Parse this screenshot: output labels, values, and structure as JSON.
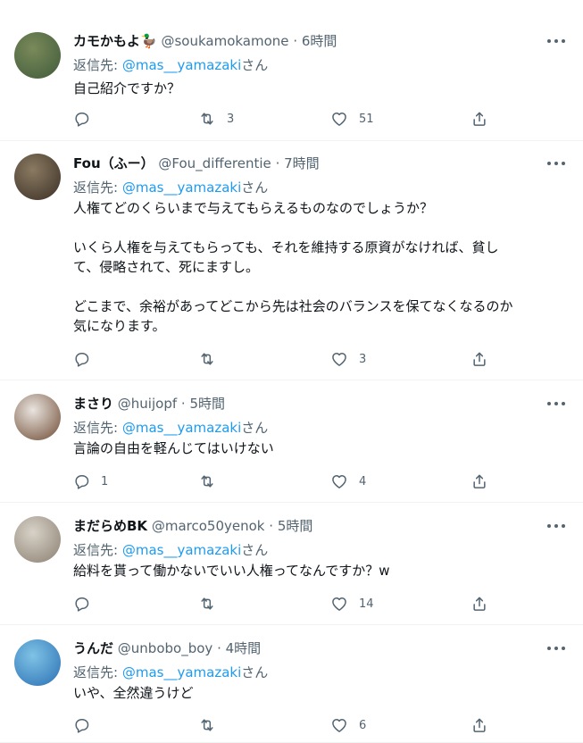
{
  "tweets": [
    {
      "name": "カモかもよ",
      "name_emoji": "🦆",
      "handle": "@soukamokamone",
      "dot": "·",
      "time": "6時間",
      "reply_prefix": "返信先:",
      "reply_to": "@mas__yamazaki",
      "reply_suffix": "さん",
      "paragraphs": [
        "自己紹介ですか？"
      ],
      "reply_count": "",
      "retweet_count": "3",
      "like_count": "51",
      "avatar_colors": [
        "#7a8a5a",
        "#3f5a3a"
      ]
    },
    {
      "name": "Fou（ふー）",
      "name_emoji": "",
      "handle": "@Fou_differentie",
      "dot": "·",
      "time": "7時間",
      "reply_prefix": "返信先:",
      "reply_to": "@mas__yamazaki",
      "reply_suffix": "さん",
      "paragraphs": [
        "人権てどのくらいまで与えてもらえるものなのでしょうか？",
        "いくら人権を与えてもらっても、それを維持する原資がなければ、貧し\nて、侵略されて、死にますし。",
        "どこまで、余裕があってどこから先は社会のバランスを保てなくなるのか\n気になります。"
      ],
      "reply_count": "",
      "retweet_count": "",
      "like_count": "3",
      "avatar_colors": [
        "#8a7a62",
        "#3b2f25"
      ]
    },
    {
      "name": "まさり",
      "name_emoji": "",
      "handle": "@huijopf",
      "dot": "·",
      "time": "5時間",
      "reply_prefix": "返信先:",
      "reply_to": "@mas__yamazaki",
      "reply_suffix": "さん",
      "paragraphs": [
        "言論の自由を軽んじてはいけない"
      ],
      "reply_count": "1",
      "retweet_count": "",
      "like_count": "4",
      "avatar_colors": [
        "#e9e4df",
        "#6e4a32"
      ]
    },
    {
      "name": "まだらめBK",
      "name_emoji": "",
      "handle": "@marco50yenok",
      "dot": "·",
      "time": "5時間",
      "reply_prefix": "返信先:",
      "reply_to": "@mas__yamazaki",
      "reply_suffix": "さん",
      "paragraphs": [
        "給料を貰って働かないでいい人権ってなんですか？w"
      ],
      "reply_count": "",
      "retweet_count": "",
      "like_count": "14",
      "avatar_colors": [
        "#d8d2c8",
        "#8a7f70"
      ]
    },
    {
      "name": "うんだ",
      "name_emoji": "",
      "handle": "@unbobo_boy",
      "dot": "·",
      "time": "4時間",
      "reply_prefix": "返信先:",
      "reply_to": "@mas__yamazaki",
      "reply_suffix": "さん",
      "paragraphs": [
        "いや、全然違うけど"
      ],
      "reply_count": "",
      "retweet_count": "",
      "like_count": "6",
      "avatar_colors": [
        "#7fc3e6",
        "#2a6fb3"
      ]
    }
  ]
}
